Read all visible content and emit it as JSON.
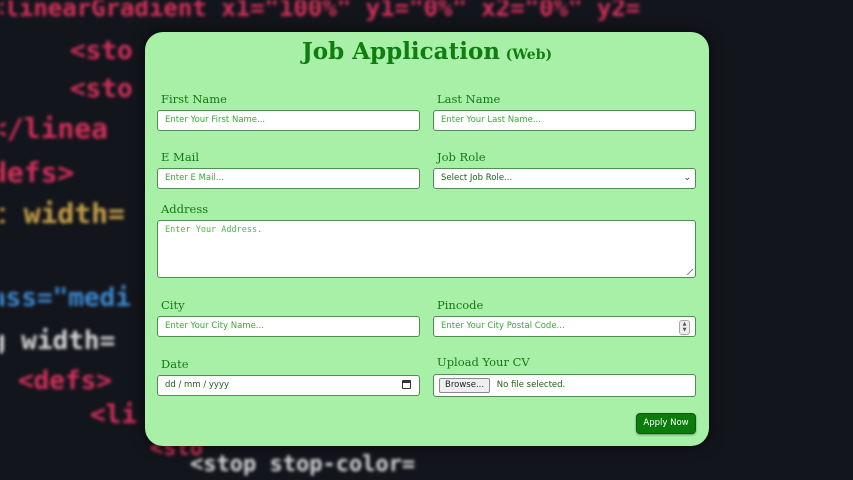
{
  "form": {
    "title": "Job Application",
    "title_suffix": "(Web)",
    "first_name": {
      "label": "First Name",
      "placeholder": "Enter Your First Name..."
    },
    "last_name": {
      "label": "Last Name",
      "placeholder": "Enter Your Last Name..."
    },
    "email": {
      "label": "E Mail",
      "placeholder": "Enter E Mail..."
    },
    "job_role": {
      "label": "Job Role",
      "selected": "Select Job Role..."
    },
    "address": {
      "label": "Address",
      "placeholder": "Enter Your Address."
    },
    "city": {
      "label": "City",
      "placeholder": "Enter Your City Name..."
    },
    "pincode": {
      "label": "Pincode",
      "placeholder": "Enter Your City Postal Code..."
    },
    "date": {
      "label": "Date",
      "placeholder": "dd / mm / yyyy"
    },
    "cv": {
      "label": "Upload Your CV",
      "browse": "Browse...",
      "status": "No file selected."
    },
    "submit": "Apply Now"
  },
  "background": {
    "lines": [
      "<linearGradient x1=\"100%\" y1=\"0%\" x2=\"0%\" y2=",
      "<sto",
      "<sto",
      "</linea",
      "defs>",
      "t width=",
      "ass=\"medi",
      "g width=",
      "<defs>",
      "<li",
      "<sto",
      "<stop stop-color="
    ]
  },
  "colors": {
    "card": "#a8f0a8",
    "accent": "#0f7d0f",
    "button": "#0b7c0b"
  }
}
